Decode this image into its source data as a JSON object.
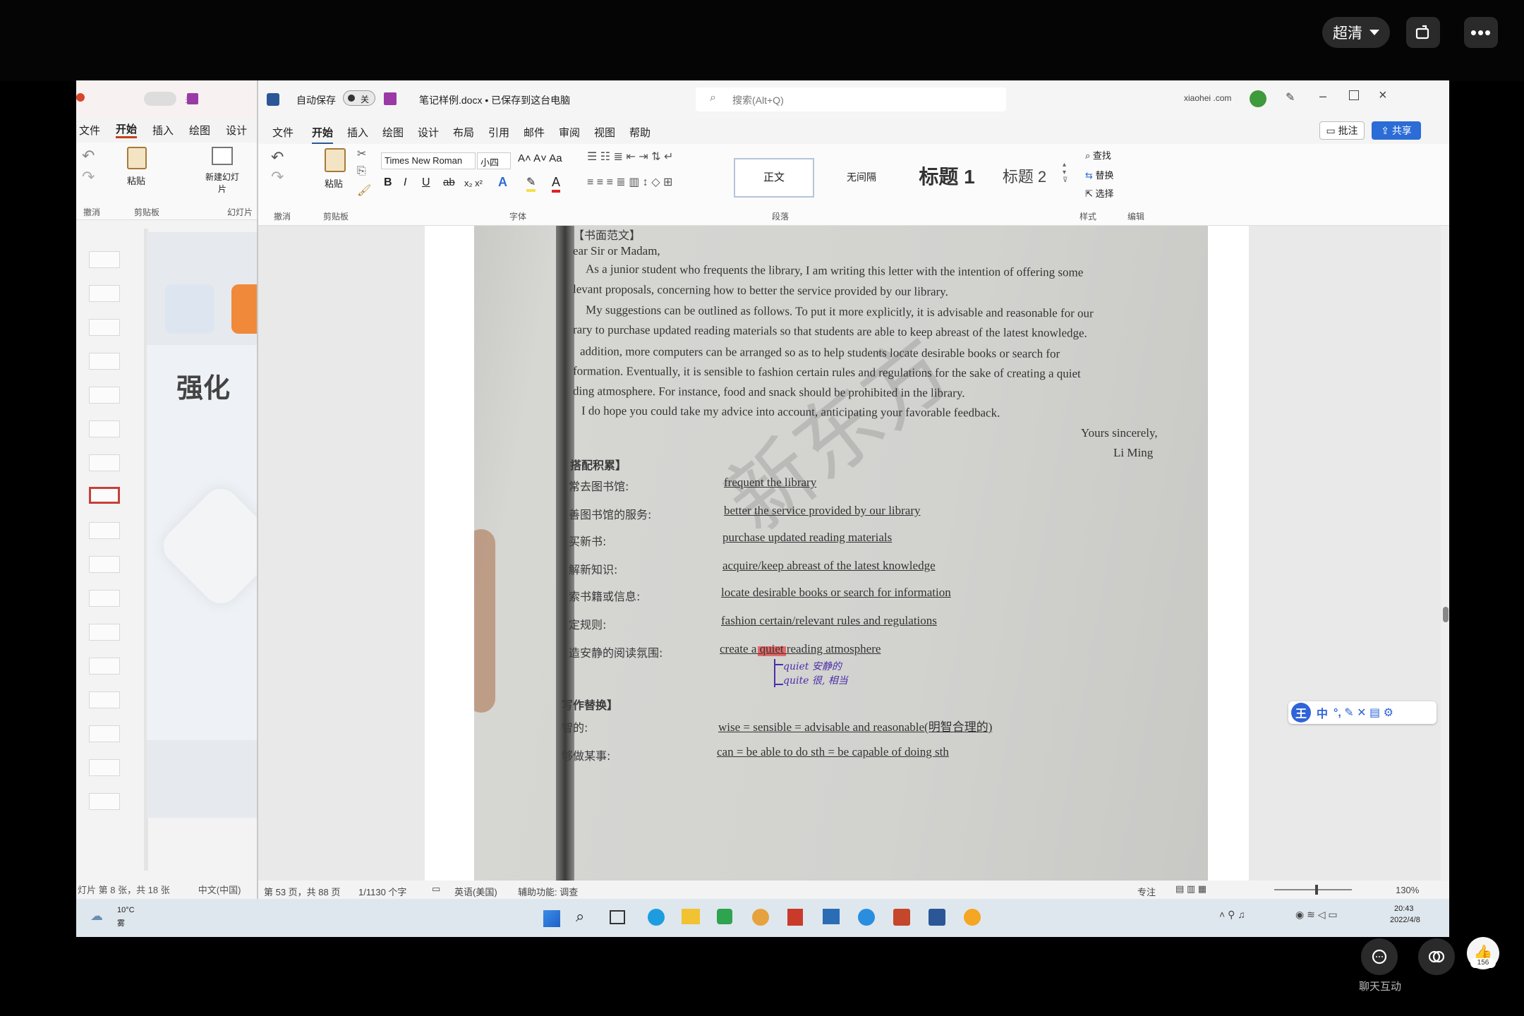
{
  "player": {
    "quality": "超清",
    "chat_label": "聊天互动",
    "like_count": "156"
  },
  "ppt": {
    "save_toggle": "关",
    "tabs": [
      "文件",
      "开始",
      "插入",
      "绘图",
      "设计"
    ],
    "groups": [
      "撤消",
      "剪贴板",
      "幻灯片"
    ],
    "paste": "粘贴",
    "new_slide": "新建幻灯片",
    "slide_title": "强化",
    "status_slide": "灯片 第 8 张，共 18 张",
    "status_lang": "中文(中国)"
  },
  "word": {
    "autosave_label": "自动保存",
    "autosave_state": "关",
    "doc_title": "笔记样例.docx • 已保存到这台电脑",
    "search_placeholder": "搜索(Alt+Q)",
    "account": "xiaohei .com",
    "tabs": [
      "文件",
      "开始",
      "插入",
      "绘图",
      "设计",
      "布局",
      "引用",
      "邮件",
      "审阅",
      "视图",
      "帮助"
    ],
    "comment_btn": "批注",
    "share_btn": "共享",
    "font_name": "Times New Roman",
    "font_size": "小四",
    "paste": "粘贴",
    "styles": [
      "正文",
      "无间隔",
      "标题 1",
      "标题 2"
    ],
    "find": "查找",
    "replace": "替换",
    "select": "选择",
    "groups": [
      "撤消",
      "剪贴板",
      "字体",
      "段落",
      "样式",
      "编辑"
    ],
    "status": {
      "page": "第 53 页，共 88 页",
      "words": "1/1130 个字",
      "lang": "英语(美国)",
      "access": "辅助功能: 调查",
      "focus": "专注",
      "zoom": "130%"
    }
  },
  "doc": {
    "heading": "【书面范文】",
    "salutation": "ear Sir or Madam,",
    "lines": [
      "As a junior student who frequents the library, I am writing this letter with the intention of offering some",
      "levant proposals, concerning how to better the service provided by our library.",
      "My suggestions can be outlined as follows. To put it more explicitly, it is advisable and reasonable for our",
      "rary to purchase updated reading materials so that students are able to keep abreast of the latest knowledge.",
      "addition, more computers can be arranged so as to help students locate desirable books or search for",
      "formation. Eventually, it is sensible to fashion certain rules and regulations for the sake of creating a quiet",
      "ding atmosphere. For instance, food and snack should be prohibited in the library.",
      "I do hope you could take my advice into account, anticipating your favorable feedback."
    ],
    "closing": "Yours sincerely,",
    "signature": "Li Ming",
    "section1": "搭配积累】",
    "pairs": [
      {
        "cn": "常去图书馆:",
        "en": "frequent the library"
      },
      {
        "cn": "善图书馆的服务:",
        "en": "better the service provided by our library"
      },
      {
        "cn": "买新书:",
        "en": "purchase updated reading materials"
      },
      {
        "cn": "解新知识:",
        "en": "acquire/keep abreast of the latest knowledge"
      },
      {
        "cn": "索书籍或信息:",
        "en": "locate desirable books or search for information"
      },
      {
        "cn": "定规则:",
        "en": "fashion certain/relevant rules and regulations"
      },
      {
        "cn": "造安静的阅读氛围:",
        "en": "create a quiet reading atmosphere"
      }
    ],
    "hand1": "quiet 安静的",
    "hand2": "quite 很, 相当",
    "section2": "写作替换】",
    "subs": [
      {
        "cn": "智的:",
        "en": "wise = sensible = advisable and reasonable(明智合理的)"
      },
      {
        "cn": "够做某事:",
        "en": "can = be able to do sth = be capable of doing sth"
      }
    ],
    "watermark": "新东方"
  },
  "ime": {
    "label": "中"
  },
  "taskbar": {
    "weather_temp": "10°C",
    "weather_desc": "雾",
    "time": "20:43",
    "date": "2022/4/8"
  }
}
